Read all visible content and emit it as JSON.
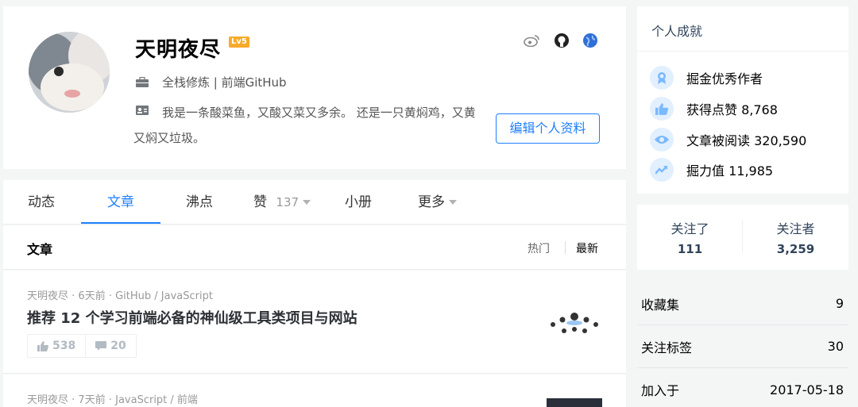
{
  "profile": {
    "username": "天明夜尽",
    "level": "Lv5",
    "job": "全栈修炼 | 前端GitHub",
    "bio": "我是一条酸菜鱼，又酸又菜又多余。 还是一只黄焖鸡，又黄又焖又垃圾。",
    "edit_label": "编辑个人资料",
    "social_icons": [
      "weibo-icon",
      "github-icon",
      "globe-icon"
    ]
  },
  "tabs": {
    "items": [
      "动态",
      "文章",
      "沸点",
      "赞",
      "小册",
      "更多"
    ],
    "like_count": "137",
    "active": "文章"
  },
  "list_header": {
    "title": "文章",
    "sort_hot": "热门",
    "sort_new": "最新"
  },
  "articles": [
    {
      "author": "天明夜尽",
      "time": "6天前",
      "tags": "GitHub / JavaScript",
      "title": "推荐 12 个学习前端必备的神仙级工具类项目与网站",
      "likes": "538",
      "comments": "20"
    },
    {
      "author": "天明夜尽",
      "time": "7天前",
      "tags": "JavaScript / 前端"
    }
  ],
  "achievements": {
    "title": "个人成就",
    "items": [
      {
        "icon": "medal-icon",
        "text": "掘金优秀作者"
      },
      {
        "icon": "thumbs-up-icon",
        "text": "获得点赞 8,768"
      },
      {
        "icon": "eye-icon",
        "text": "文章被阅读 320,590"
      },
      {
        "icon": "trend-icon",
        "text": "掘力值 11,985"
      }
    ]
  },
  "follow": {
    "following_label": "关注了",
    "following": "111",
    "followers_label": "关注者",
    "followers": "3,259"
  },
  "stats": [
    {
      "label": "收藏集",
      "value": "9"
    },
    {
      "label": "关注标签",
      "value": "30"
    },
    {
      "label": "加入于",
      "value": "2017-05-18"
    }
  ],
  "colors": {
    "accent": "#1e80ff",
    "level_badge": "#f7a92b"
  }
}
